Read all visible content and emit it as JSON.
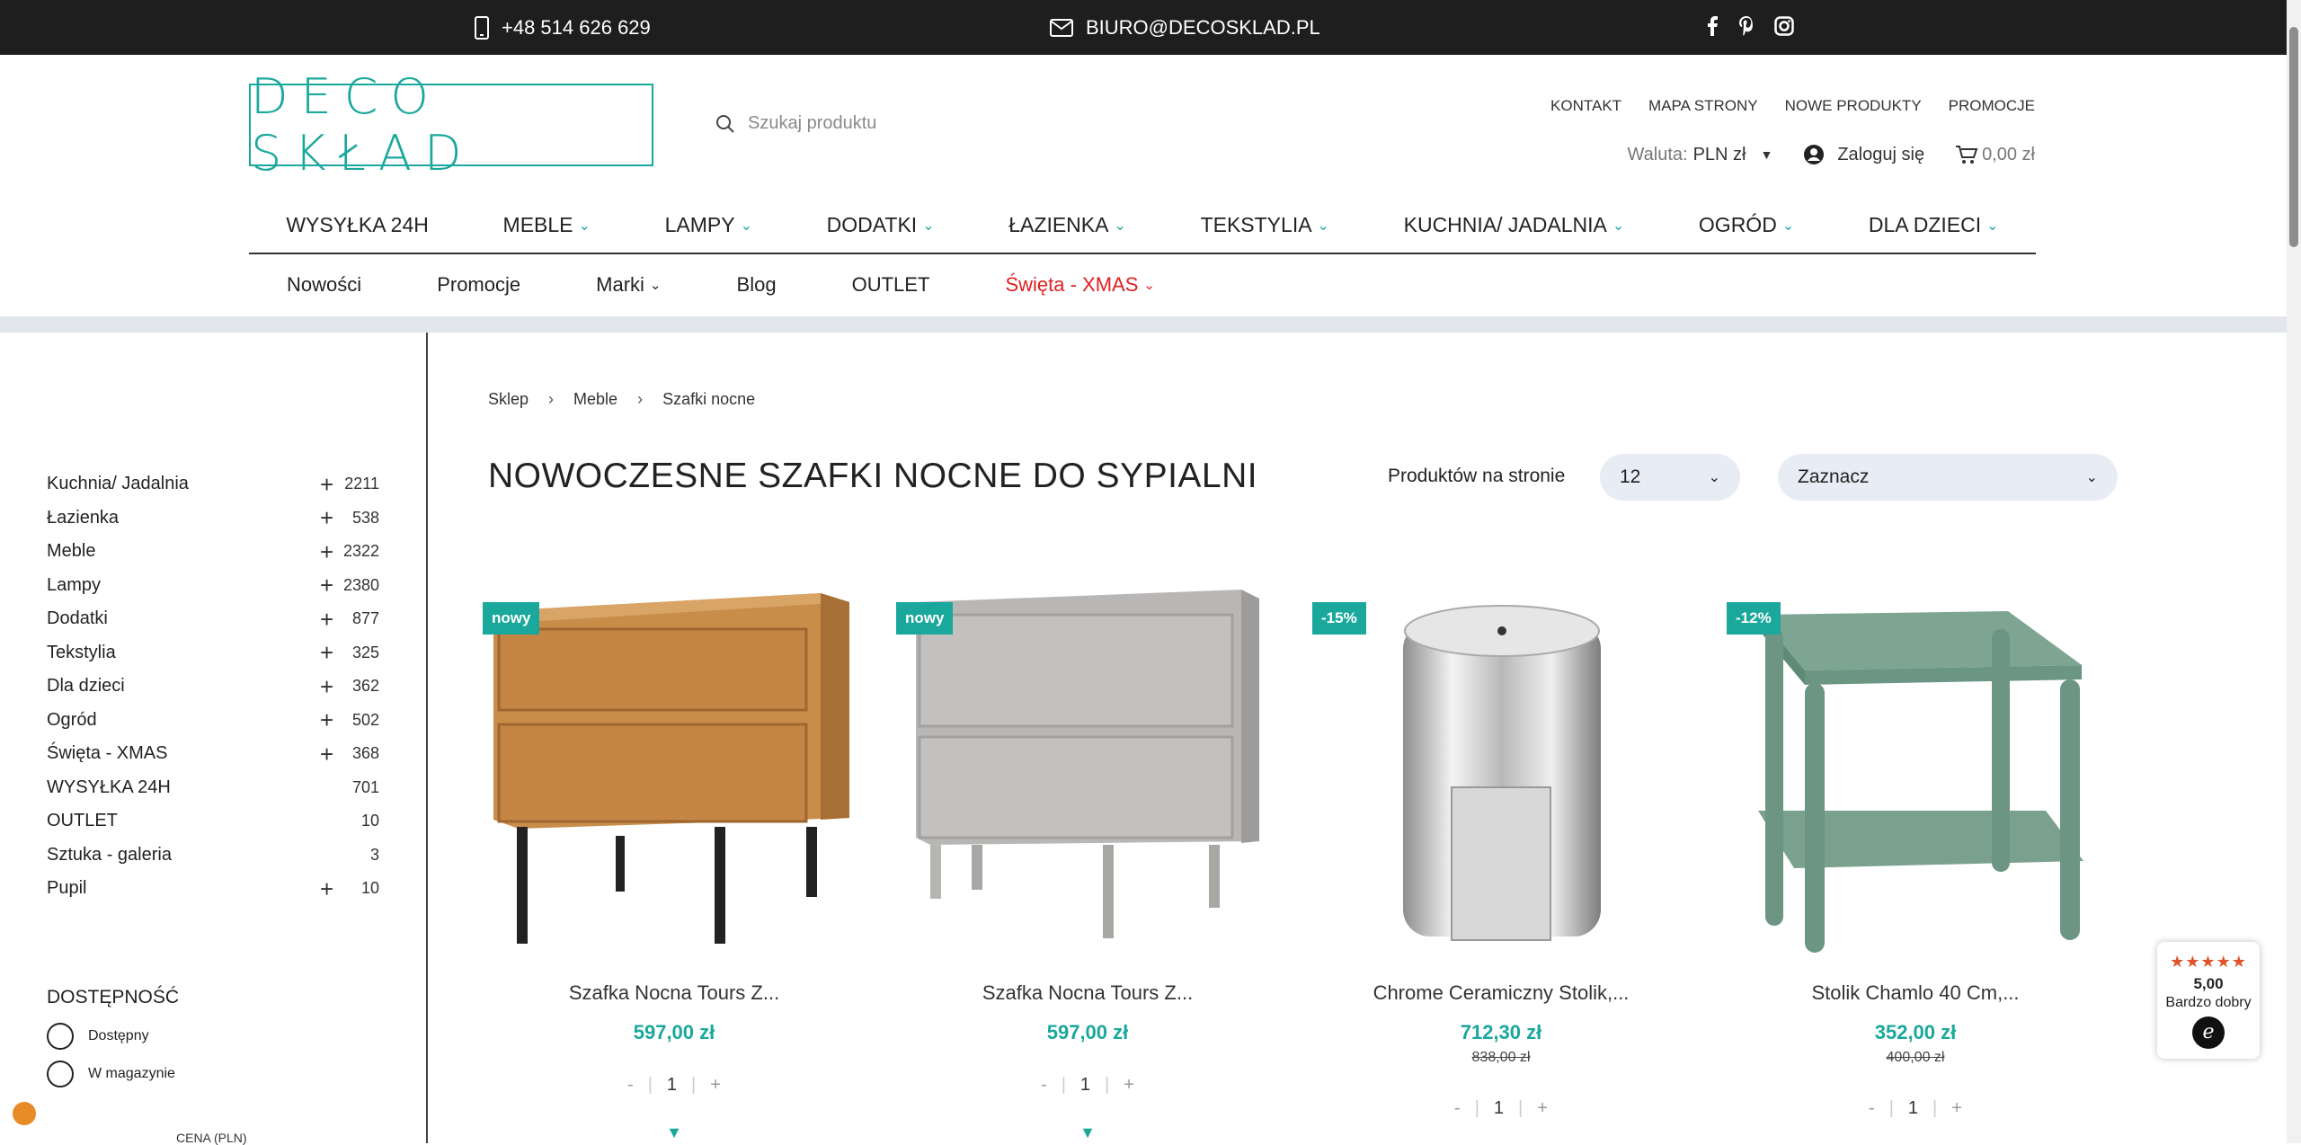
{
  "topbar": {
    "phone": "+48 514 626 629",
    "email": "BIURO@DECOSKLAD.PL",
    "social": [
      "facebook-icon",
      "pinterest-icon",
      "instagram-icon"
    ]
  },
  "header": {
    "logo_text": "DECO SKŁAD",
    "search_placeholder": "Szukaj produktu",
    "links": [
      "KONTAKT",
      "MAPA STRONY",
      "NOWE PRODUKTY",
      "PROMOCJE"
    ],
    "currency_label": "Waluta:",
    "currency_value": "PLN zł",
    "login": "Zaloguj się",
    "cart_total": "0,00 zł"
  },
  "main_nav": [
    "WYSYŁKA 24H",
    "MEBLE",
    "LAMPY",
    "DODATKI",
    "ŁAZIENKA",
    "TEKSTYLIA",
    "KUCHNIA/ JADALNIA",
    "OGRÓD",
    "DLA DZIECI"
  ],
  "sub_nav": [
    "Nowości",
    "Promocje",
    "Marki",
    "Blog",
    "OUTLET",
    "Święta - XMAS"
  ],
  "sidebar": {
    "categories": [
      {
        "name": "Kuchnia/ Jadalnia",
        "count": "2211"
      },
      {
        "name": "Łazienka",
        "count": "538"
      },
      {
        "name": "Meble",
        "count": "2322"
      },
      {
        "name": "Lampy",
        "count": "2380"
      },
      {
        "name": "Dodatki",
        "count": "877"
      },
      {
        "name": "Tekstylia",
        "count": "325"
      },
      {
        "name": "Dla dzieci",
        "count": "362"
      },
      {
        "name": "Ogród",
        "count": "502"
      },
      {
        "name": "Święta - XMAS",
        "count": "368"
      },
      {
        "name": "WYSYŁKA 24H",
        "count": "701"
      },
      {
        "name": "OUTLET",
        "count": "10"
      },
      {
        "name": "Sztuka - galeria",
        "count": "3"
      },
      {
        "name": "Pupil",
        "count": "10"
      }
    ],
    "availability_title": "DOSTĘPNOŚĆ",
    "availability_options": [
      "Dostępny",
      "W magazynie"
    ],
    "price_title": "CENA (PLN)"
  },
  "breadcrumb": [
    "Sklep",
    "Meble",
    "Szafki nocne"
  ],
  "page_title": "NOWOCZESNE SZAFKI NOCNE DO SYPIALNI",
  "toolbar": {
    "per_page_label": "Produktów na stronie",
    "per_page_value": "12",
    "sort_value": "Zaznacz"
  },
  "products": [
    {
      "badge": "nowy",
      "name": "Szafka Nocna Tours Z...",
      "price": "597,00 zł",
      "old_price": "",
      "qty": "1"
    },
    {
      "badge": "nowy",
      "name": "Szafka Nocna Tours Z...",
      "price": "597,00 zł",
      "old_price": "",
      "qty": "1"
    },
    {
      "badge": "-15%",
      "name": "Chrome Ceramiczny Stolik,...",
      "price": "712,30 zł",
      "old_price": "838,00 zł",
      "qty": "1"
    },
    {
      "badge": "-12%",
      "name": "Stolik Chamlo 40 Cm,...",
      "price": "352,00 zł",
      "old_price": "400,00 zł",
      "qty": "1"
    }
  ],
  "rating_widget": {
    "stars": "★★★★★",
    "score": "5,00",
    "label": "Bardzo dobry"
  },
  "colors": {
    "accent": "#1aa89c",
    "xmas": "#e02020",
    "topbar": "#1e1e1e"
  }
}
